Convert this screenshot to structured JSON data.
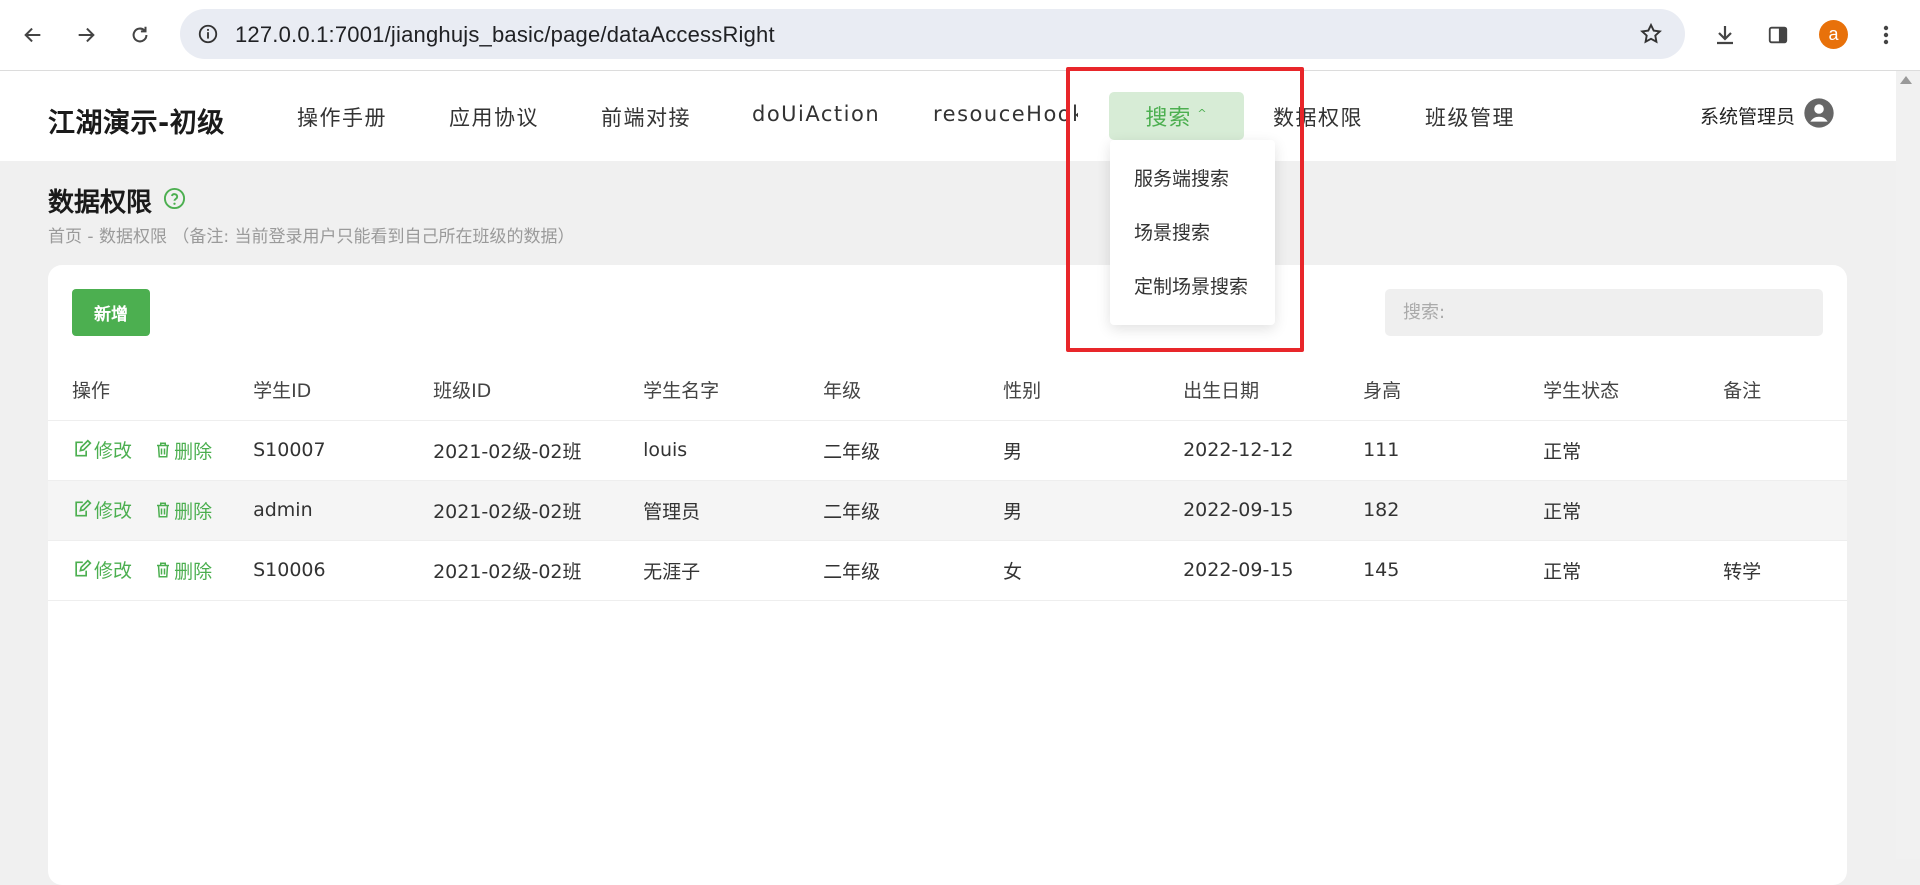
{
  "browser": {
    "url": "127.0.0.1:7001/jianghujs_basic/page/dataAccessRight",
    "profile_initial": "a",
    "icons": [
      "back-icon",
      "forward-icon",
      "reload-icon",
      "site-info-icon",
      "bookmark-star-icon",
      "download-icon",
      "side-panel-icon",
      "kebab-menu-icon"
    ]
  },
  "header": {
    "brand": "江湖演示-初级",
    "menu": [
      "操作手册",
      "应用协议",
      "前端对接",
      "doUiAction",
      "resouceHook"
    ],
    "active_menu": "搜索",
    "menu_after": [
      "数据权限",
      "班级管理"
    ],
    "user": "系统管理员"
  },
  "dropdown": {
    "items": [
      "服务端搜索",
      "场景搜索",
      "定制场景搜索"
    ]
  },
  "page": {
    "title": "数据权限",
    "breadcrumb": "首页 - 数据权限 （备注: 当前登录用户只能看到自己所在班级的数据）"
  },
  "toolbar": {
    "add_label": "新增",
    "search_placeholder": "搜索:"
  },
  "table": {
    "columns": [
      "操作",
      "学生ID",
      "班级ID",
      "学生名字",
      "年级",
      "性别",
      "出生日期",
      "身高",
      "学生状态",
      "备注"
    ],
    "edit_label": "修改",
    "delete_label": "删除",
    "rows": [
      [
        "S10007",
        "2021-02级-02班",
        "louis",
        "二年级",
        "男",
        "2022-12-12",
        "111",
        "正常",
        ""
      ],
      [
        "admin",
        "2021-02级-02班",
        "管理员",
        "二年级",
        "男",
        "2022-09-15",
        "182",
        "正常",
        ""
      ],
      [
        "S10006",
        "2021-02级-02班",
        "无涯子",
        "二年级",
        "女",
        "2022-09-15",
        "145",
        "正常",
        "转学"
      ]
    ]
  },
  "colors": {
    "accent": "#4caf50",
    "active_menu_bg": "#d7ecd6",
    "highlight": "#e8262a"
  }
}
